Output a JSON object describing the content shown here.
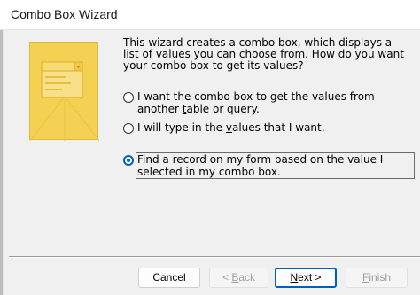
{
  "window": {
    "title": "Combo Box Wizard"
  },
  "intro_text": "This wizard creates a combo box, which displays a list of values you can choose from.  How do you want your combo box to get its values?",
  "options": [
    {
      "label_pre": "I want the combo box to get the values from another ",
      "label_underlined": "t",
      "label_post": "able or query.",
      "checked": false
    },
    {
      "label_pre": "I will type in the ",
      "label_underlined": "v",
      "label_post": "alues that I want.",
      "checked": false
    },
    {
      "label_pre": "Find a record on my form based on the value I selected in my combo box.",
      "label_underlined": "",
      "label_post": "",
      "checked": true
    }
  ],
  "buttons": {
    "cancel": "Cancel",
    "back_symbol": "<",
    "back_underlined": "B",
    "back_rest": "ack",
    "next_underlined": "N",
    "next_rest": "ext",
    "next_symbol": ">",
    "finish_underlined": "F",
    "finish_rest": "inish"
  },
  "colors": {
    "accent": "#005fb8",
    "illustration": "#f4d153"
  },
  "illustration": {
    "icon": "combo-box-wizard-illustration"
  }
}
